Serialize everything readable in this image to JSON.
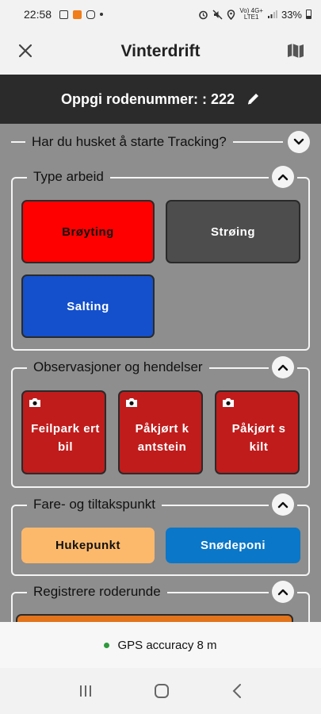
{
  "status_bar": {
    "time": "22:58",
    "network": "Vo) 4G+\nLTE1",
    "battery": "33%"
  },
  "header": {
    "title": "Vinterdrift"
  },
  "rode": {
    "label": "Oppgi rodenummer: : 222"
  },
  "tracking": {
    "text": "Har du husket å starte Tracking?"
  },
  "type_arbeid": {
    "title": "Type arbeid",
    "buttons": [
      "Brøyting",
      "Strøing",
      "Salting"
    ]
  },
  "observasjoner": {
    "title": "Observasjoner og hendelser",
    "buttons": [
      "Feilpark ert bil",
      "Påkjørt k antstein",
      "Påkjørt s kilt"
    ]
  },
  "fare": {
    "title": "Fare- og tiltakspunkt",
    "buttons": [
      "Hukepunkt",
      "Snødeponi"
    ]
  },
  "roderunde": {
    "title": "Registrere roderunde"
  },
  "gps": {
    "text": "GPS accuracy 8 m"
  },
  "colors": {
    "red": "#ff0000",
    "grey": "#4d4d4d",
    "blue": "#1450cc",
    "obs_red": "#c01c1c",
    "orange": "#fdb96b",
    "cyan": "#0a77c8",
    "dark_bar": "#2b2b2b",
    "gps_green": "#2e9a3c"
  },
  "icons": [
    "close-icon",
    "map-icon",
    "edit-icon",
    "chevron-down-icon",
    "chevron-up-icon",
    "camera-icon",
    "recent-apps-icon",
    "home-icon",
    "back-icon"
  ]
}
